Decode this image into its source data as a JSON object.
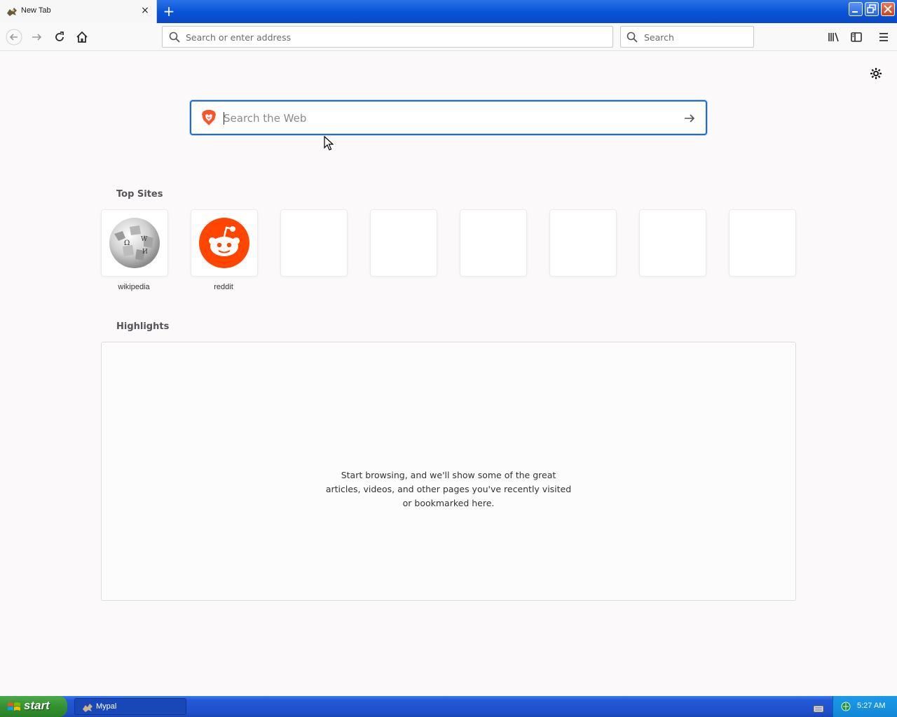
{
  "browser": {
    "tab": {
      "title": "New Tab",
      "favicon": "mypal-icon",
      "close": "×"
    },
    "new_tab": "+",
    "urlbar": {
      "placeholder": "Search or enter address"
    },
    "searchbar": {
      "placeholder": "Search"
    }
  },
  "newtab_page": {
    "web_search": {
      "placeholder": "Search the Web",
      "engine_icon": "brave-lion-icon"
    },
    "top_sites": {
      "title": "Top Sites",
      "tiles": [
        {
          "label": "wikipedia",
          "icon": "wikipedia-globe-icon"
        },
        {
          "label": "reddit",
          "icon": "reddit-alien-icon"
        },
        {
          "label": ""
        },
        {
          "label": ""
        },
        {
          "label": ""
        },
        {
          "label": ""
        },
        {
          "label": ""
        },
        {
          "label": ""
        }
      ]
    },
    "highlights": {
      "title": "Highlights",
      "empty_message": "Start browsing, and we'll show some of the great articles, videos, and other pages you've recently visited or bookmarked here."
    }
  },
  "taskbar": {
    "start_label": "start",
    "task": "Mypal",
    "clock": "5:27 AM"
  },
  "colors": {
    "accent": "#1e6bd6",
    "reddit": "#ff4500",
    "taskbar_blue": "#245edb",
    "start_green": "#3c9a39"
  }
}
